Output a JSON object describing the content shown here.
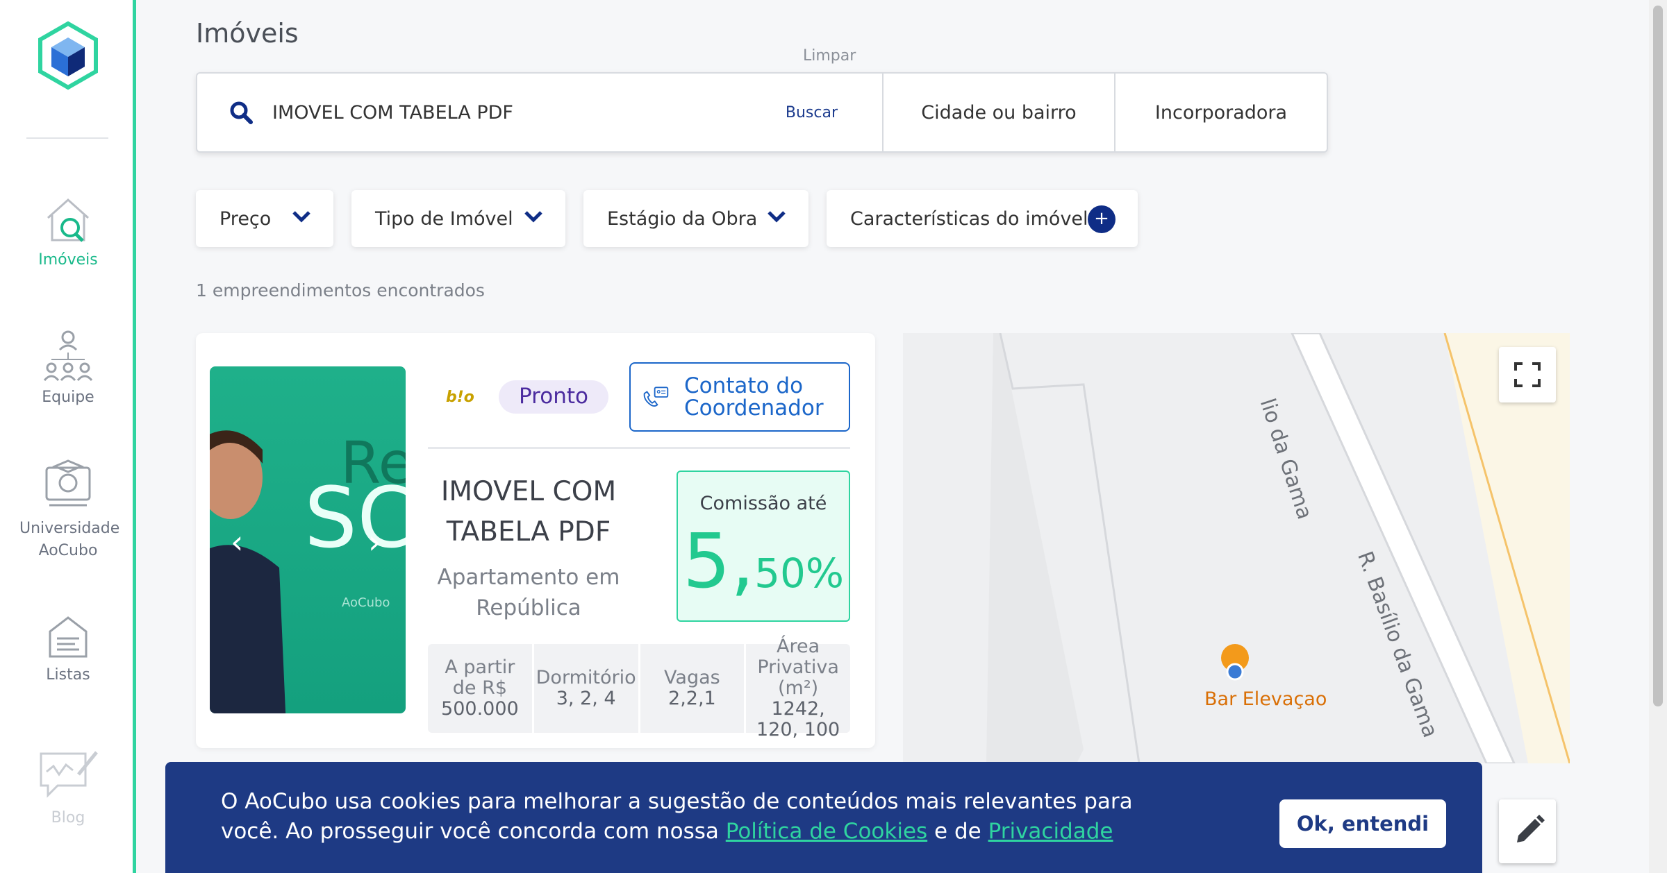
{
  "sidebar": {
    "items": [
      {
        "label": "Imóveis",
        "icon": "house-search-icon"
      },
      {
        "label": "Equipe",
        "icon": "team-icon"
      },
      {
        "label": "Universidade AoCubo",
        "icon": "university-icon"
      },
      {
        "label": "Listas",
        "icon": "list-icon"
      },
      {
        "label": "Blog",
        "icon": "blog-icon"
      }
    ]
  },
  "page": {
    "title": "Imóveis",
    "clear_label": "Limpar"
  },
  "search": {
    "value": "IMOVEL COM TABELA PDF",
    "button_label": "Buscar",
    "city_label": "Cidade ou bairro",
    "developer_label": "Incorporadora"
  },
  "filters": {
    "price": "Preço",
    "type": "Tipo de Imóvel",
    "stage": "Estágio da Obra",
    "features": "Características do imóvel",
    "features_plus": "+"
  },
  "results": {
    "count_text": "1 empreendimentos encontrados"
  },
  "card": {
    "brand": "b!o",
    "image_text": {
      "a": "Re",
      "b": "SC",
      "c": "AoCubo"
    },
    "status": "Pronto",
    "contact_label": "Contato do Coordenador",
    "title": "IMOVEL COM TABELA PDF",
    "type": "Apartamento em República",
    "commission": {
      "label": "Comissão até",
      "value_int": "5,",
      "value_dec": "50%"
    },
    "stats": [
      {
        "label": "A partir de R$",
        "value": "500.000"
      },
      {
        "label": "Dormitório",
        "value": "3, 2, 4"
      },
      {
        "label": "Vagas",
        "value": "2,2,1"
      },
      {
        "label": "Área Privativa (m²)",
        "value": "1242, 120, 100"
      }
    ]
  },
  "map": {
    "street1": "lio da Gama",
    "street2": "R. Basílio da Gama",
    "poi": "Bar Elevaçao"
  },
  "cookie": {
    "text_pre": "O AoCubo usa cookies para melhorar a sugestão de conteúdos mais relevantes para você. Ao prosseguir você concorda com nossa ",
    "link1": "Política de Cookies",
    "text_mid": " e de ",
    "link2": "Privacidade",
    "ok_label": "Ok, entendi"
  },
  "colors": {
    "accent": "#2fd4a0",
    "navy": "#1e3a84",
    "link_blue": "#1b66c9"
  }
}
